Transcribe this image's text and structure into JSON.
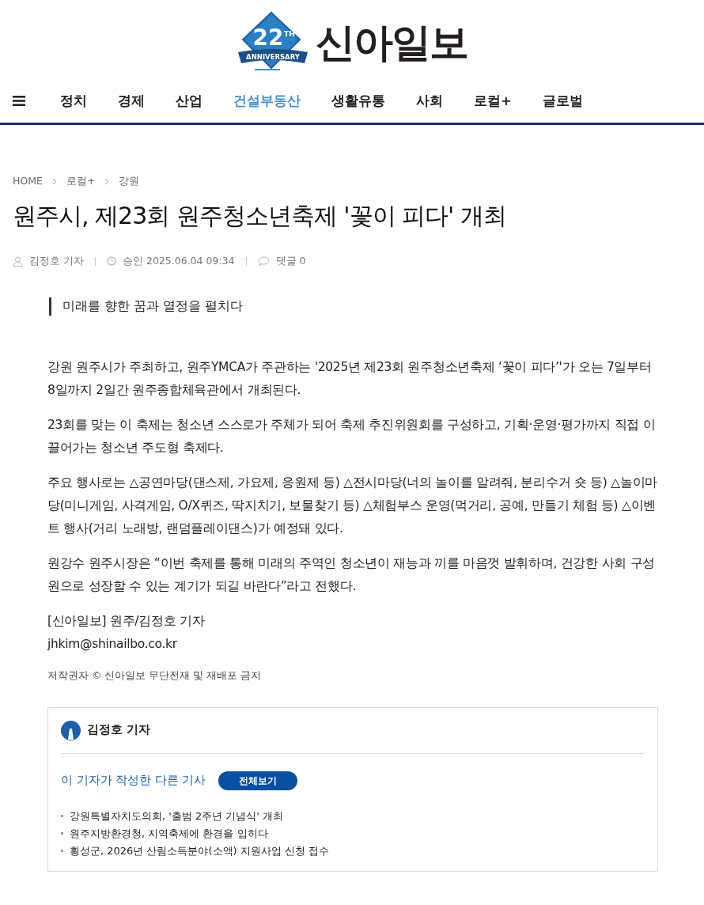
{
  "logo": {
    "badge_number": "22",
    "badge_suffix": "TH",
    "badge_ribbon": "ANNIVERSARY",
    "name": "신아일보"
  },
  "nav": [
    {
      "label": "정치",
      "selected": false
    },
    {
      "label": "경제",
      "selected": false
    },
    {
      "label": "산업",
      "selected": false
    },
    {
      "label": "건설부동산",
      "selected": true
    },
    {
      "label": "생활유통",
      "selected": false
    },
    {
      "label": "사회",
      "selected": false
    },
    {
      "label": "로컬+",
      "selected": false
    },
    {
      "label": "글로벌",
      "selected": false
    }
  ],
  "breadcrumb": [
    "HOME",
    "로컬+",
    "강원"
  ],
  "article": {
    "title": "원주시, 제23회 원주청소년축제 '꽃이 피다' 개최",
    "meta": {
      "author": "김정호 기자",
      "approved": "승인 2025.06.04 09:34",
      "comments": "댓글 0"
    },
    "subtitle": "미래를 향한 꿈과 열정을 펼치다",
    "paragraphs": [
      "강원 원주시가 주최하고, 원주YMCA가 주관하는 '2025년 제23회 원주청소년축제 ‘꽃이 피다’'가 오는 7일부터 8일까지 2일간 원주종합체육관에서 개최된다.",
      "23회를 맞는 이 축제는 청소년 스스로가 주체가 되어 축제 추진위원회를 구성하고, 기획·운영·평가까지 직접 이끌어가는 청소년 주도형 축제다.",
      "주요 행사로는 △공연마당(댄스제, 가요제, 응원제 등) △전시마당(너의 놀이를 알려줘, 분리수거 숏 등) △놀이마당(미니게임, 사격게임, O/X퀴즈, 딱지치기, 보물찾기 등) △체험부스 운영(먹거리, 공예, 만들기 체험 등) △이벤트 행사(거리 노래방, 랜덤플레이댄스)가 예정돼 있다.",
      "원강수 원주시장은 “이번 축제를 통해 미래의 주역인 청소년이 재능과 끼를 마음껏 발휘하며, 건강한 사회 구성원으로 성장할 수 있는 계기가 되길 바란다”라고 전했다."
    ],
    "byline": [
      "[신아일보] 원주/김정호 기자",
      "jhkim@shinailbo.co.kr"
    ],
    "copyright": "저작권자 © 신아일보 무단전재 및 재배포 금지"
  },
  "reporter_box": {
    "name": "김정호 기자",
    "other_label": "이 기자가 작성한 다른 기사",
    "view_all": "전체보기",
    "articles": [
      "강원특별자치도의회, '출범 2주년 기념식' 개최",
      "원주지방환경청, 지역축제에 환경을 입히다",
      "횡성군, 2026년 산림소득분야(소액) 지원사업 신청 접수"
    ]
  }
}
